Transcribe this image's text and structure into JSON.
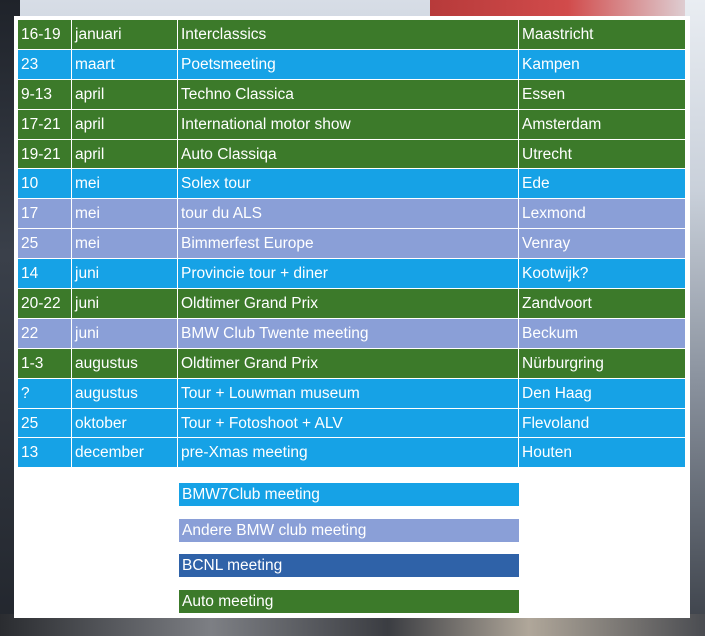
{
  "colors": {
    "bmw7club": "#16a2e6",
    "other_bmw_club": "#8a9fd7",
    "bcnl": "#2f62a8",
    "auto": "#3c7a2a"
  },
  "events": [
    {
      "date": "16-19",
      "month": "januari",
      "name": "Interclassics",
      "place": "Maastricht",
      "type": "auto"
    },
    {
      "date": "23",
      "month": "maart",
      "name": "Poetsmeeting",
      "place": "Kampen",
      "type": "bmw7club"
    },
    {
      "date": "9-13",
      "month": "april",
      "name": "Techno Classica",
      "place": "Essen",
      "type": "auto"
    },
    {
      "date": "17-21",
      "month": "april",
      "name": "International motor show",
      "place": "Amsterdam",
      "type": "auto"
    },
    {
      "date": "19-21",
      "month": "april",
      "name": "Auto Classiqa",
      "place": "Utrecht",
      "type": "auto"
    },
    {
      "date": "10",
      "month": "mei",
      "name": "Solex tour",
      "place": "Ede",
      "type": "bmw7club"
    },
    {
      "date": "17",
      "month": "mei",
      "name": "tour du ALS",
      "place": "Lexmond",
      "type": "other_bmw_club"
    },
    {
      "date": "25",
      "month": "mei",
      "name": "Bimmerfest Europe",
      "place": "Venray",
      "type": "other_bmw_club"
    },
    {
      "date": "14",
      "month": "juni",
      "name": "Provincie tour + diner",
      "place": "Kootwijk?",
      "type": "bmw7club"
    },
    {
      "date": "20-22",
      "month": "juni",
      "name": "Oldtimer Grand Prix",
      "place": "Zandvoort",
      "type": "auto"
    },
    {
      "date": "22",
      "month": "juni",
      "name": "BMW Club Twente meeting",
      "place": "Beckum",
      "type": "other_bmw_club"
    },
    {
      "date": "1-3",
      "month": "augustus",
      "name": "Oldtimer Grand Prix",
      "place": "Nürburgring",
      "type": "auto"
    },
    {
      "date": "?",
      "month": "augustus",
      "name": "Tour + Louwman museum",
      "place": "Den Haag",
      "type": "bmw7club"
    },
    {
      "date": "25",
      "month": "oktober",
      "name": "Tour + Fotoshoot + ALV",
      "place": "Flevoland",
      "type": "bmw7club"
    },
    {
      "date": "13",
      "month": "december",
      "name": "pre-Xmas meeting",
      "place": "Houten",
      "type": "bmw7club"
    }
  ],
  "legend": [
    {
      "label": "BMW7Club meeting",
      "type": "bmw7club"
    },
    {
      "label": "Andere BMW club meeting",
      "type": "other_bmw_club"
    },
    {
      "label": "BCNL meeting",
      "type": "bcnl"
    },
    {
      "label": "Auto meeting",
      "type": "auto"
    }
  ]
}
